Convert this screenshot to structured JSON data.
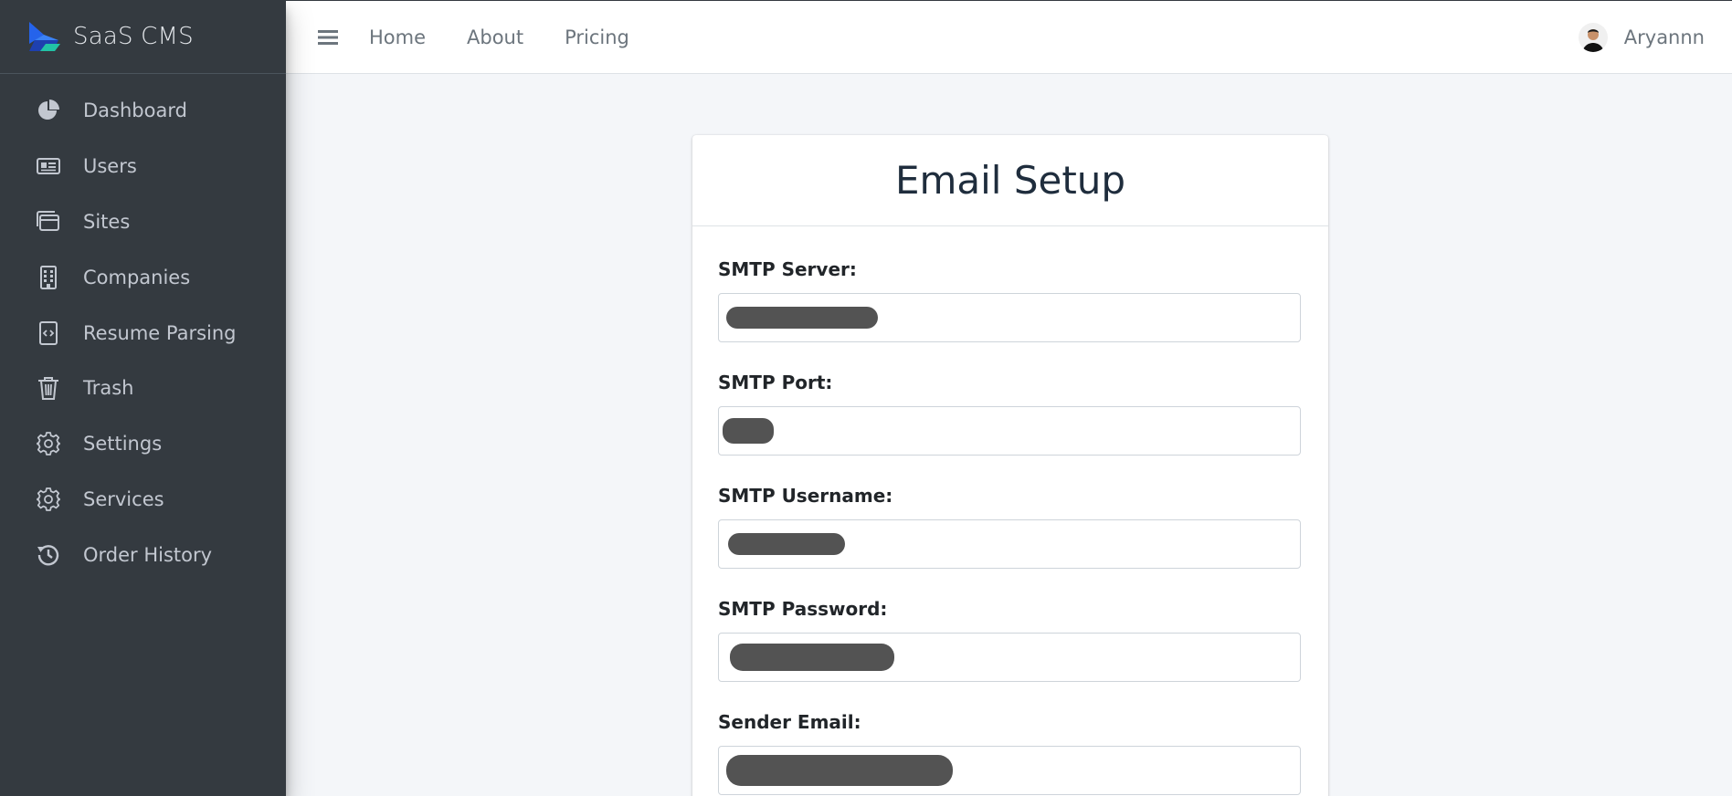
{
  "brand": {
    "name": "SaaS CMS",
    "icon": "logo-icon"
  },
  "sidebar": {
    "items": [
      {
        "label": "Dashboard",
        "icon": "pie-chart-icon"
      },
      {
        "label": "Users",
        "icon": "id-card-icon"
      },
      {
        "label": "Sites",
        "icon": "browser-window-icon"
      },
      {
        "label": "Companies",
        "icon": "building-icon"
      },
      {
        "label": "Resume Parsing",
        "icon": "code-file-icon"
      },
      {
        "label": "Trash",
        "icon": "trash-icon"
      },
      {
        "label": "Settings",
        "icon": "gear-icon"
      },
      {
        "label": "Services",
        "icon": "gear-icon"
      },
      {
        "label": "Order History",
        "icon": "history-icon"
      }
    ]
  },
  "header": {
    "links": [
      "Home",
      "About",
      "Pricing"
    ],
    "user": {
      "name": "Aryannn"
    }
  },
  "form": {
    "title": "Email Setup",
    "fields": [
      {
        "label": "SMTP Server:",
        "value": ""
      },
      {
        "label": "SMTP Port:",
        "value": ""
      },
      {
        "label": "SMTP Username:",
        "value": ""
      },
      {
        "label": "SMTP Password:",
        "value": ""
      },
      {
        "label": "Sender Email:",
        "value": ""
      }
    ]
  },
  "colors": {
    "sidebar_bg": "#343a40",
    "sidebar_text": "#c2c7d0",
    "accent": "#3b82f6",
    "redaction": "#535353"
  }
}
